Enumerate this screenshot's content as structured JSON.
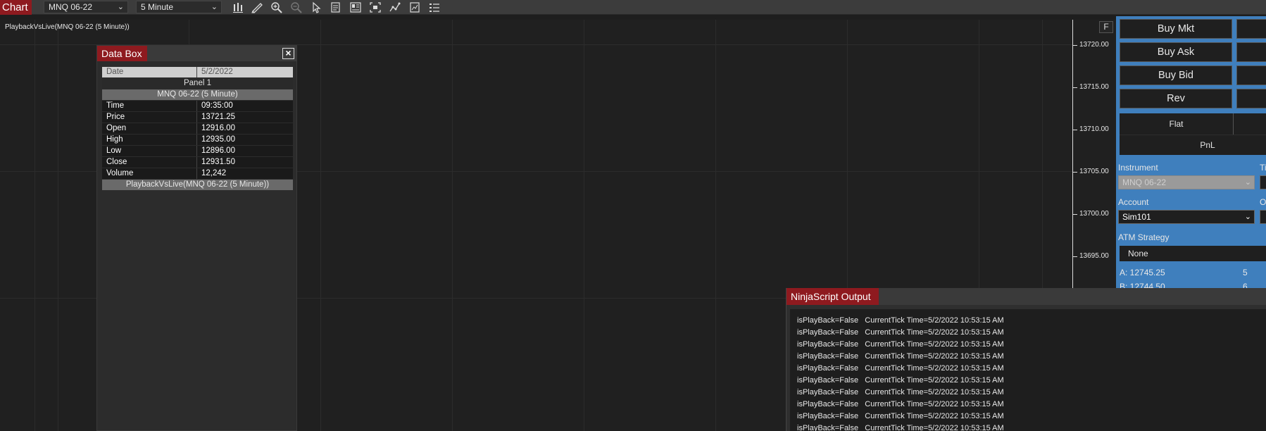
{
  "toolbar": {
    "chart_tab": "Chart",
    "instrument": "MNQ 06-22",
    "interval": "5 Minute",
    "icons": [
      "bars-type-icon",
      "drawing-tool-icon",
      "zoom-in-icon",
      "zoom-out-icon",
      "pointer-icon",
      "data-box-icon",
      "properties-icon",
      "snapshot-icon",
      "indicators-icon",
      "strategies-icon",
      "list-icon"
    ]
  },
  "chart": {
    "label": "PlaybackVsLive(MNQ 06-22 (5 Minute))",
    "f_button": "F",
    "price_levels": [
      "13720.00",
      "13715.00",
      "13710.00",
      "13705.00",
      "13700.00",
      "13695.00"
    ]
  },
  "databox": {
    "title": "Data Box",
    "date_label": "Date",
    "date_value": "5/2/2022",
    "panel": "Panel 1",
    "instrument": "MNQ 06-22 (5 Minute)",
    "rows": [
      {
        "k": "Time",
        "v": "09:35:00"
      },
      {
        "k": "Price",
        "v": "13721.25"
      },
      {
        "k": "Open",
        "v": "12916.00"
      },
      {
        "k": "High",
        "v": "12935.00"
      },
      {
        "k": "Low",
        "v": "12896.00"
      },
      {
        "k": "Close",
        "v": "12931.50"
      },
      {
        "k": "Volume",
        "v": "12,242"
      }
    ],
    "footer": "PlaybackVsLive(MNQ 06-22 (5 Minute))"
  },
  "trader": {
    "buy_mkt": "Buy Mkt",
    "buy_ask": "Buy Ask",
    "buy_bid": "Buy Bid",
    "rev": "Rev",
    "flat": "Flat",
    "pnl": "PnL",
    "instrument_label": "Instrument",
    "instrument_value": "MNQ 06-22",
    "account_label": "Account",
    "account_value": "Sim101",
    "atm_label": "ATM Strategy",
    "atm_value": "None",
    "t_cut": "Ti",
    "o_cut": "O",
    "ask": "A:  12745.25",
    "ask_size": "5",
    "bid": "B:  12744.50",
    "bid_size": "6"
  },
  "output": {
    "title": "NinjaScript Output",
    "lines": [
      "isPlayBack=False   CurrentTick Time=5/2/2022 10:53:15 AM",
      "isPlayBack=False   CurrentTick Time=5/2/2022 10:53:15 AM",
      "isPlayBack=False   CurrentTick Time=5/2/2022 10:53:15 AM",
      "isPlayBack=False   CurrentTick Time=5/2/2022 10:53:15 AM",
      "isPlayBack=False   CurrentTick Time=5/2/2022 10:53:15 AM",
      "isPlayBack=False   CurrentTick Time=5/2/2022 10:53:15 AM",
      "isPlayBack=False   CurrentTick Time=5/2/2022 10:53:15 AM",
      "isPlayBack=False   CurrentTick Time=5/2/2022 10:53:15 AM",
      "isPlayBack=False   CurrentTick Time=5/2/2022 10:53:15 AM",
      "isPlayBack=False   CurrentTick Time=5/2/2022 10:53:15 AM"
    ]
  }
}
